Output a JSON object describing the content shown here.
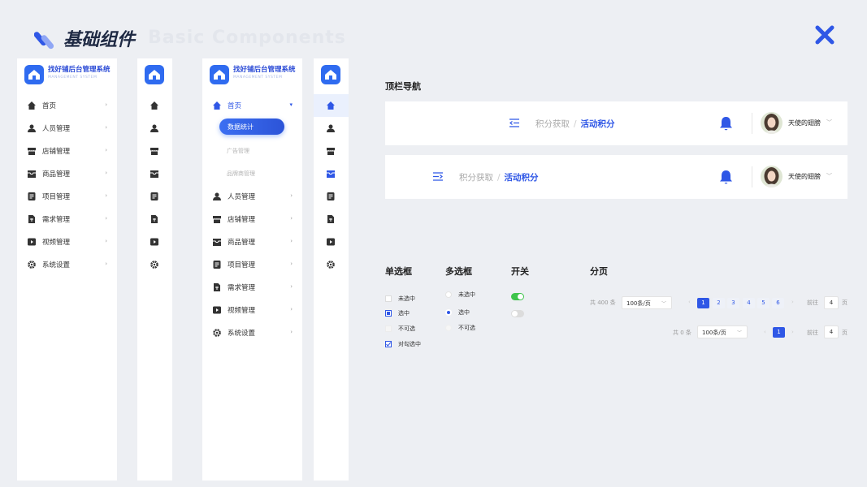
{
  "header": {
    "title": "基础组件",
    "ghost_title": "Basic Components"
  },
  "brand": {
    "name": "找好铺后台管理系统",
    "subtitle": "MANAGEMENT SYSTEM"
  },
  "sidebar": {
    "items": [
      {
        "label": "首页",
        "icon": "home-icon"
      },
      {
        "label": "人员管理",
        "icon": "user-icon"
      },
      {
        "label": "店铺管理",
        "icon": "store-icon"
      },
      {
        "label": "商品管理",
        "icon": "box-icon"
      },
      {
        "label": "项目管理",
        "icon": "project-icon"
      },
      {
        "label": "需求管理",
        "icon": "demand-icon"
      },
      {
        "label": "视频管理",
        "icon": "video-icon"
      },
      {
        "label": "系统设置",
        "icon": "gear-icon"
      }
    ],
    "home_submenu": [
      "数据统计",
      "广告管理",
      "品牌商管理"
    ]
  },
  "topnav": {
    "section_title": "顶栏导航",
    "breadcrumb": [
      "积分获取",
      "活动积分"
    ],
    "user_name": "天使的翅膀"
  },
  "components": {
    "radio": {
      "title": "单选框",
      "options": [
        "未选中",
        "选中",
        "不可选",
        "对勾选中"
      ]
    },
    "checkbox": {
      "title": "多选框",
      "options": [
        "未选中",
        "选中",
        "不可选"
      ]
    },
    "switch": {
      "title": "开关",
      "states": [
        "on",
        "off"
      ]
    },
    "pagination": {
      "title": "分页",
      "row1": {
        "total": "共 400 条",
        "page_size": "100条/页",
        "pages": [
          "1",
          "2",
          "3",
          "4",
          "5",
          "6"
        ],
        "current": "1",
        "goto_label": "前往",
        "goto_value": "4",
        "unit": "页"
      },
      "row2": {
        "total": "共 0 条",
        "page_size": "100条/页",
        "pages": [
          "1"
        ],
        "current": "1",
        "goto_label": "前往",
        "goto_value": "4",
        "unit": "页"
      }
    }
  },
  "colors": {
    "primary": "#2f57e6",
    "switch_on": "#3ec44b",
    "background": "#edeff3"
  }
}
